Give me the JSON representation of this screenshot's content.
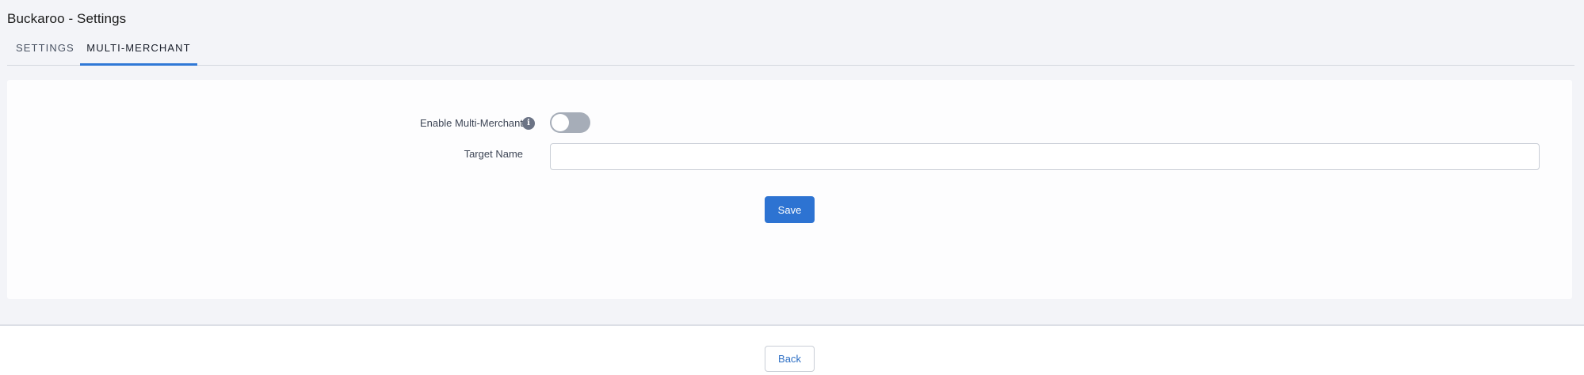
{
  "header": {
    "title": "Buckaroo - Settings"
  },
  "tabs": [
    {
      "label": "SETTINGS",
      "active": false
    },
    {
      "label": "MULTI-MERCHANT",
      "active": true
    }
  ],
  "form": {
    "enable_multi_merchant": {
      "label": "Enable Multi-Merchant",
      "info_icon": "info-icon",
      "checked": false
    },
    "target_name": {
      "label": "Target Name",
      "value": "",
      "placeholder": ""
    },
    "save_label": "Save"
  },
  "footer": {
    "back_label": "Back"
  },
  "colors": {
    "accent": "#2d73d2",
    "toggle_off": "#a6adb8",
    "background": "#f3f4f8"
  }
}
